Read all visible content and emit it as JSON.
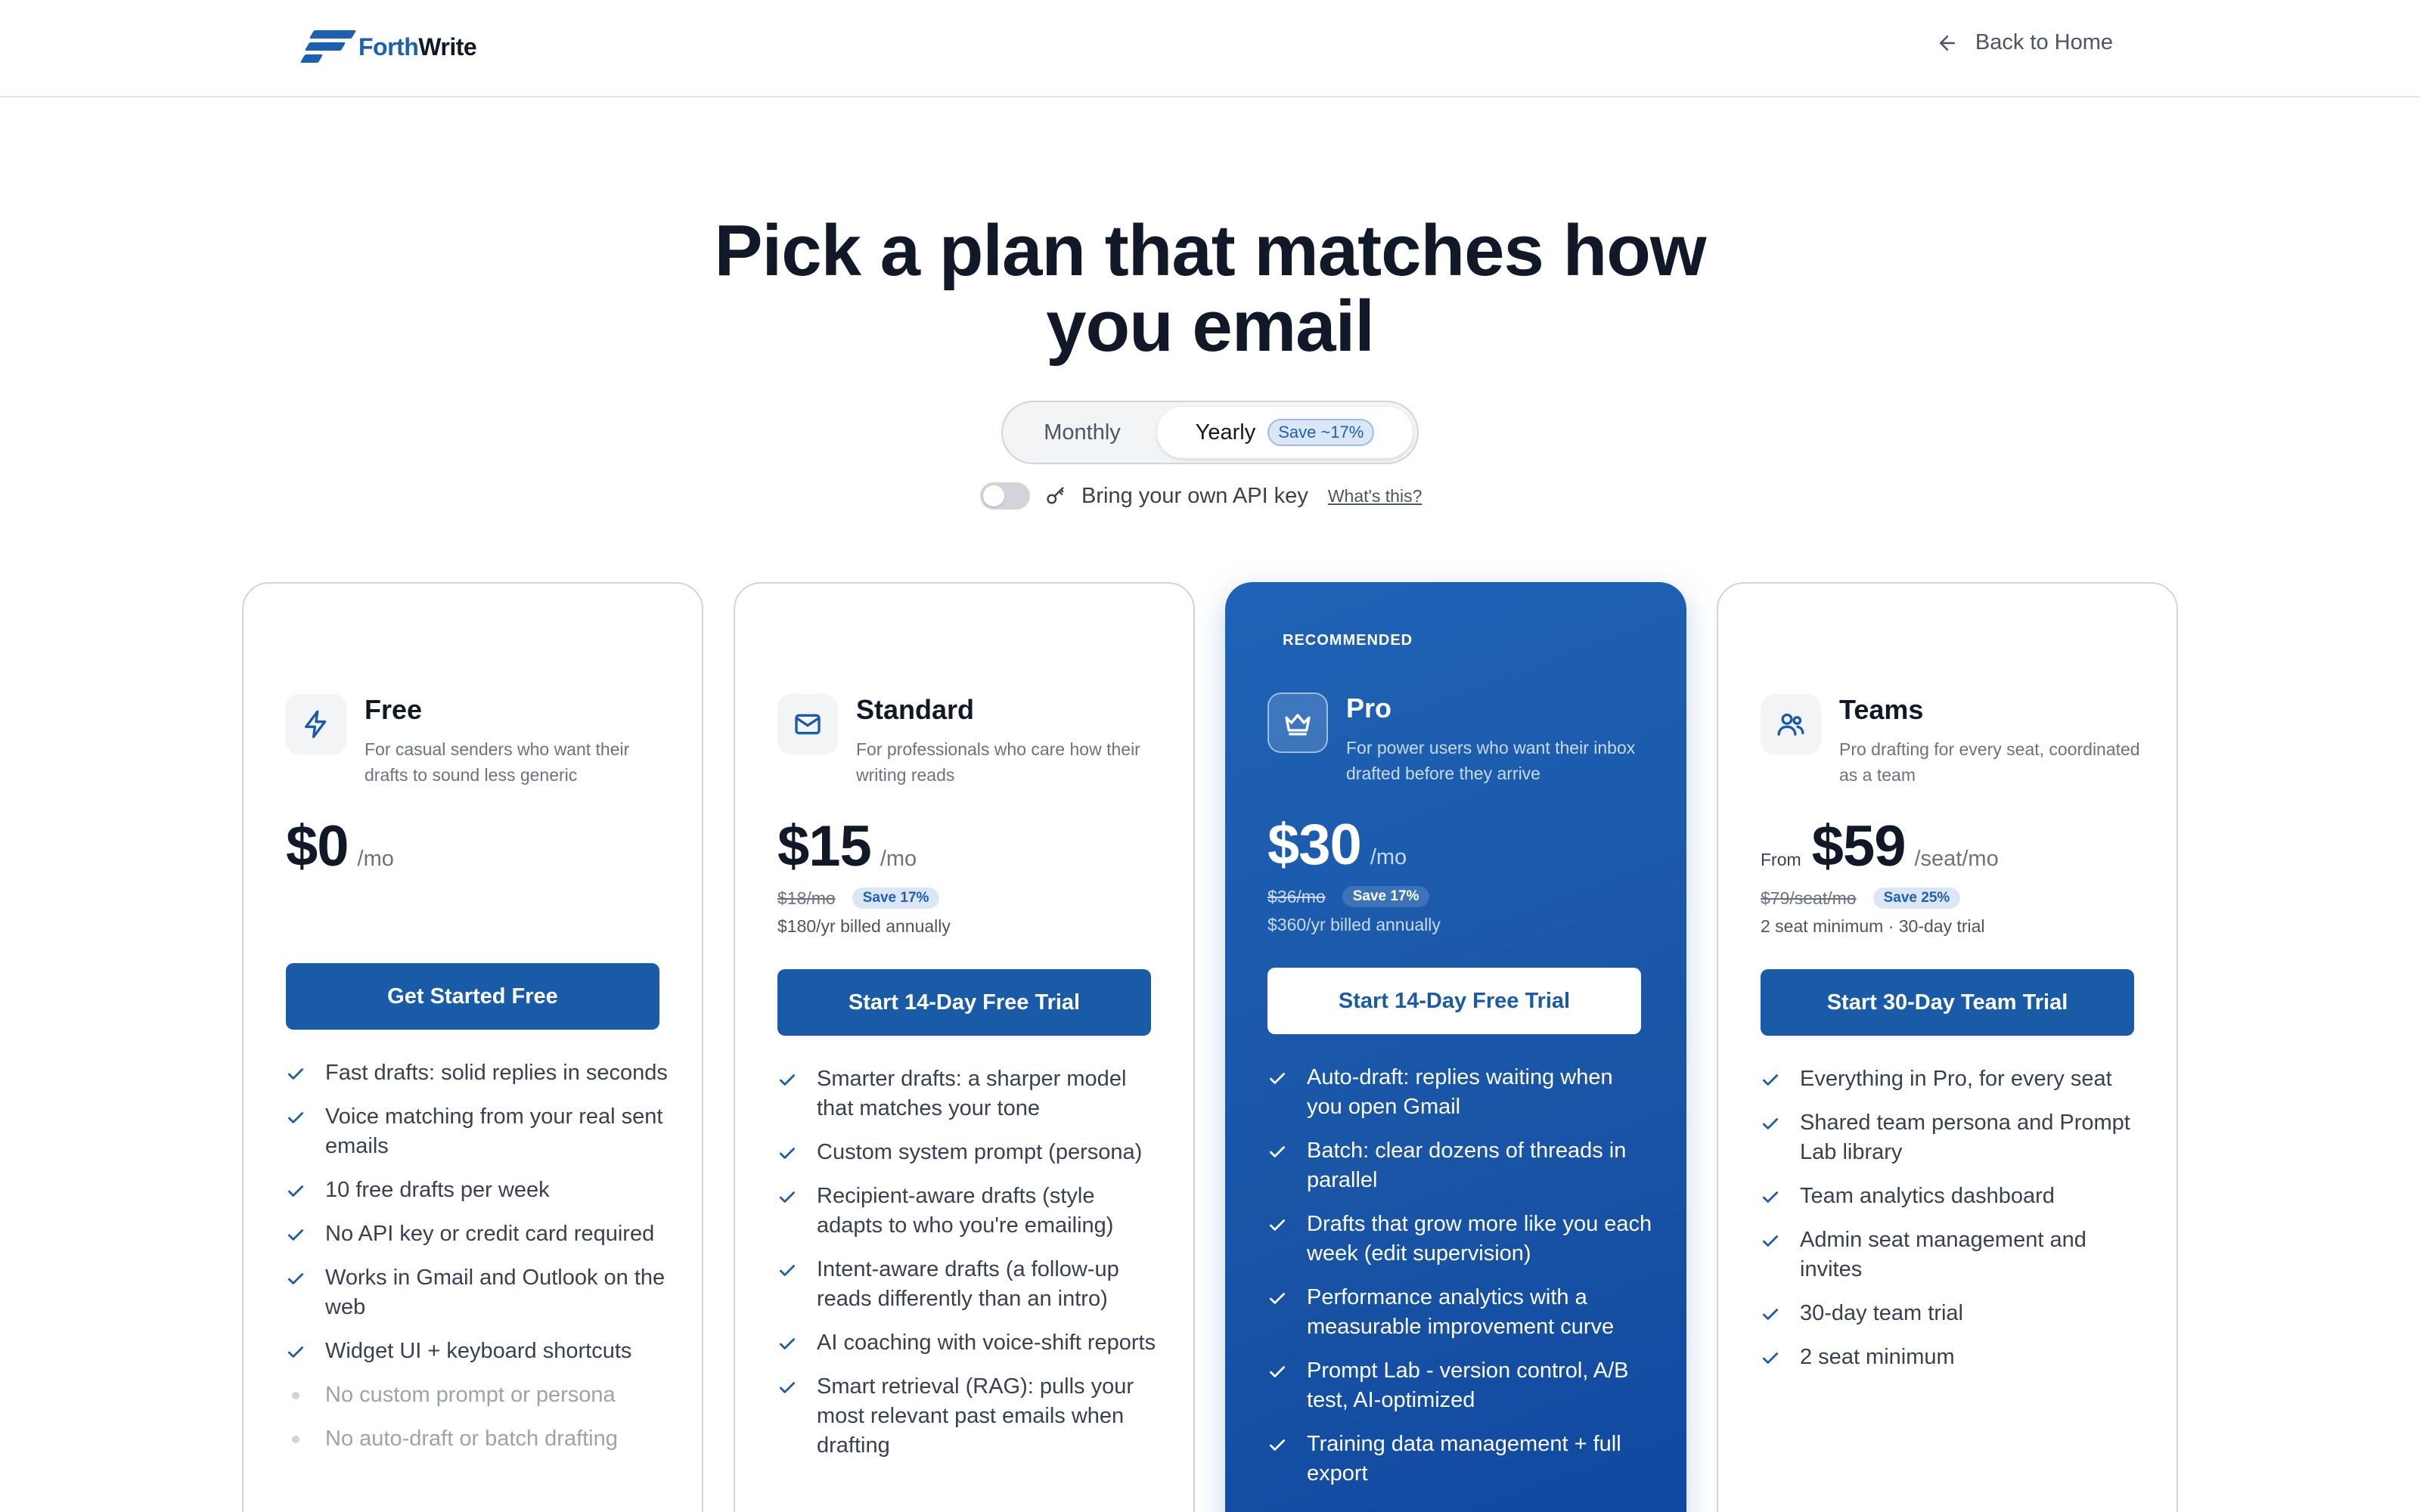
{
  "header": {
    "logo": {
      "brand_blue": "Forth",
      "brand_dark": "Write"
    },
    "back_link": "Back to Home"
  },
  "hero": {
    "title_line1": "Pick a plan that matches how",
    "title_line2": "you email"
  },
  "billing": {
    "options": [
      "Monthly",
      "Yearly"
    ],
    "selected": "Yearly",
    "save_badge": "Save ~17%"
  },
  "api_key": {
    "label": "Bring your own API key",
    "enabled": false,
    "help_link": "What's this?"
  },
  "colors": {
    "brand_blue": "#1a5ba8",
    "pro_card_bg": "#1a55a6",
    "text": "#111827"
  },
  "plans": [
    {
      "name": "Free",
      "icon": "lightning-icon",
      "description": "For casual senders who want their drafts to sound less generic",
      "price": "$0",
      "per": "/mo",
      "cta": "Get Started Free",
      "features": [
        "Fast drafts: solid replies in seconds",
        "Voice matching from your real sent emails",
        "10 free drafts per week",
        "No API key or credit card required",
        "Works in Gmail and Outlook on the web",
        "Widget UI + keyboard shortcuts"
      ],
      "excluded": [
        "No custom prompt or persona",
        "No auto-draft or batch drafting"
      ]
    },
    {
      "name": "Standard",
      "icon": "envelope-icon",
      "description": "For professionals who care how their writing reads",
      "price": "$15",
      "per": "/mo",
      "old_price": "$18/mo",
      "save": "Save 17%",
      "billed": "$180/yr billed annually",
      "cta": "Start 14-Day Free Trial",
      "features": [
        "Smarter drafts: a sharper model that matches your tone",
        "Custom system prompt (persona)",
        "Recipient-aware drafts (style adapts to who you're emailing)",
        "Intent-aware drafts (a follow-up reads differently than an intro)",
        "AI coaching with voice-shift reports",
        "Smart retrieval (RAG): pulls your most relevant past emails when drafting"
      ]
    },
    {
      "name": "Pro",
      "icon": "crown-icon",
      "badge": "RECOMMENDED",
      "description": "For power users who want their inbox drafted before they arrive",
      "price": "$30",
      "per": "/mo",
      "old_price": "$36/mo",
      "save": "Save 17%",
      "billed": "$360/yr billed annually",
      "cta": "Start 14-Day Free Trial",
      "features": [
        "Auto-draft: replies waiting when you open Gmail",
        "Batch: clear dozens of threads in parallel",
        "Drafts that grow more like you each week (edit supervision)",
        "Performance analytics with a measurable improvement curve",
        "Prompt Lab - version control, A/B test, AI-optimized",
        "Training data management + full export"
      ]
    },
    {
      "name": "Teams",
      "icon": "users-icon",
      "description": "Pro drafting for every seat, coordinated as a team",
      "price_prefix": "From",
      "price": "$59",
      "per": "/seat/mo",
      "old_price": "$79/seat/mo",
      "save": "Save 25%",
      "billed": "2 seat minimum · 30-day trial",
      "cta": "Start 30-Day Team Trial",
      "features": [
        "Everything in Pro, for every seat",
        "Shared team persona and Prompt Lab library",
        "Team analytics dashboard",
        "Admin seat management and invites",
        "30-day team trial",
        "2 seat minimum"
      ]
    }
  ]
}
